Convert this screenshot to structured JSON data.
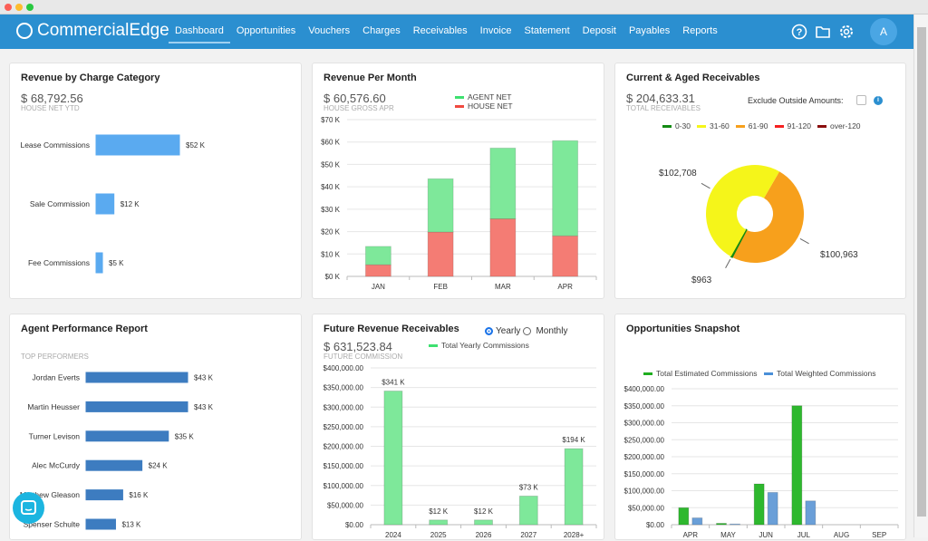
{
  "header": {
    "brand": "CommercialEdge",
    "nav": [
      "Dashboard",
      "Opportunities",
      "Vouchers",
      "Charges",
      "Receivables",
      "Invoice",
      "Statement",
      "Deposit",
      "Payables",
      "Reports"
    ],
    "active": "Dashboard",
    "avatar": "A",
    "icons": [
      "help-icon",
      "folder-icon",
      "gear-icon"
    ],
    "color": "#2b8fd0"
  },
  "revenue_category": {
    "title": "Revenue by Charge Category",
    "amount": "$ 68,792.56",
    "amount_label": "HOUSE NET YTD",
    "chart_data": {
      "type": "bar",
      "orientation": "horizontal",
      "categories": [
        "Lease Commissions",
        "Sale Commission",
        "Fee Commissions"
      ],
      "values": [
        52,
        12,
        5
      ],
      "data_labels": [
        "$52 K",
        "$12 K",
        "$5 K"
      ],
      "unit": "K",
      "color": "#5aaaf0"
    }
  },
  "revenue_month": {
    "title": "Revenue Per Month",
    "amount": "$ 60,576.60",
    "amount_label": "HOUSE GROSS APR",
    "chart_data": {
      "type": "bar",
      "stacked": true,
      "categories": [
        "JAN",
        "FEB",
        "MAR",
        "APR"
      ],
      "series": [
        {
          "name": "HOUSE NET",
          "values": [
            5.2,
            19.8,
            25.7,
            18.1
          ],
          "color": "#f47c74"
        },
        {
          "name": "AGENT NET",
          "values": [
            8.2,
            23.8,
            31.6,
            42.5
          ],
          "color": "#7ee89a"
        }
      ],
      "ylim": [
        0,
        70
      ],
      "yticks": [
        "$0 K",
        "$10 K",
        "$20 K",
        "$30 K",
        "$40 K",
        "$50 K",
        "$60 K",
        "$70 K"
      ],
      "grid": true,
      "legend": "top"
    }
  },
  "aged": {
    "title": "Current & Aged Receivables",
    "amount": "$ 204,633.31",
    "amount_label": "TOTAL RECEIVABLES",
    "exclude_label": "Exclude Outside Amounts:",
    "exclude_checked": false,
    "chart_data": {
      "type": "pie",
      "donut": true,
      "legend": [
        {
          "name": "0-30",
          "color": "#138a13"
        },
        {
          "name": "31-60",
          "color": "#f5f51a"
        },
        {
          "name": "61-90",
          "color": "#f7a01c"
        },
        {
          "name": "91-120",
          "color": "#f52020"
        },
        {
          "name": "over-120",
          "color": "#8a0d0d"
        }
      ],
      "slices": [
        {
          "name": "61-90",
          "value": 100963,
          "label": "$100,963",
          "color": "#f7a01c"
        },
        {
          "name": "0-30",
          "value": 963,
          "label": "$963",
          "color": "#138a13"
        },
        {
          "name": "31-60",
          "value": 102708,
          "label": "$102,708",
          "color": "#f5f51a"
        }
      ]
    }
  },
  "agents": {
    "title": "Agent Performance Report",
    "subtitle": "TOP PERFORMERS",
    "chart_data": {
      "type": "bar",
      "orientation": "horizontal",
      "categories": [
        "Jordan Everts",
        "Martin Heusser",
        "Turner Levison",
        "Alec McCurdy",
        "Matthew Gleason",
        "Spenser Schulte"
      ],
      "values": [
        43,
        43,
        35,
        24,
        16,
        13
      ],
      "data_labels": [
        "$43 K",
        "$43 K",
        "$35 K",
        "$24 K",
        "$16 K",
        "$13 K"
      ],
      "unit": "K",
      "color": "#3d7cc0"
    }
  },
  "future": {
    "title": "Future Revenue Receivables",
    "amount": "$ 631,523.84",
    "amount_label": "FUTURE COMMISSION",
    "radio": [
      "Yearly",
      "Monthly"
    ],
    "radio_selected": "Yearly",
    "chart_data": {
      "type": "bar",
      "categories": [
        "2024",
        "2025",
        "2026",
        "2027",
        "2028+"
      ],
      "series": [
        {
          "name": "Total Yearly Commissions",
          "values": [
            341000,
            12000,
            12000,
            73000,
            194000
          ],
          "color": "#7ee89a"
        }
      ],
      "data_labels": [
        "$341 K",
        "$12 K",
        "$12 K",
        "$73 K",
        "$194 K"
      ],
      "ylim": [
        0,
        400000
      ],
      "yticks": [
        "$0.00",
        "$50,000.00",
        "$100,000.00",
        "$150,000.00",
        "$200,000.00",
        "$250,000.00",
        "$300,000.00",
        "$350,000.00",
        "$400,000.00"
      ],
      "grid": true,
      "legend": "top"
    }
  },
  "opps": {
    "title": "Opportunities Snapshot",
    "chart_data": {
      "type": "bar",
      "categories": [
        "APR",
        "MAY",
        "JUN",
        "JUL",
        "AUG",
        "SEP"
      ],
      "series": [
        {
          "name": "Total Estimated Commissions",
          "values": [
            50000,
            4000,
            120000,
            350000,
            0,
            0
          ],
          "color": "#2eb82e"
        },
        {
          "name": "Total Weighted Commissions",
          "values": [
            20000,
            2000,
            95000,
            70000,
            0,
            0
          ],
          "color": "#6a9fd8"
        }
      ],
      "ylim": [
        0,
        400000
      ],
      "yticks": [
        "$0.00",
        "$50,000.00",
        "$100,000.00",
        "$150,000.00",
        "$200,000.00",
        "$250,000.00",
        "$300,000.00",
        "$350,000.00",
        "$400,000.00"
      ],
      "grid": true,
      "legend": "top"
    }
  }
}
